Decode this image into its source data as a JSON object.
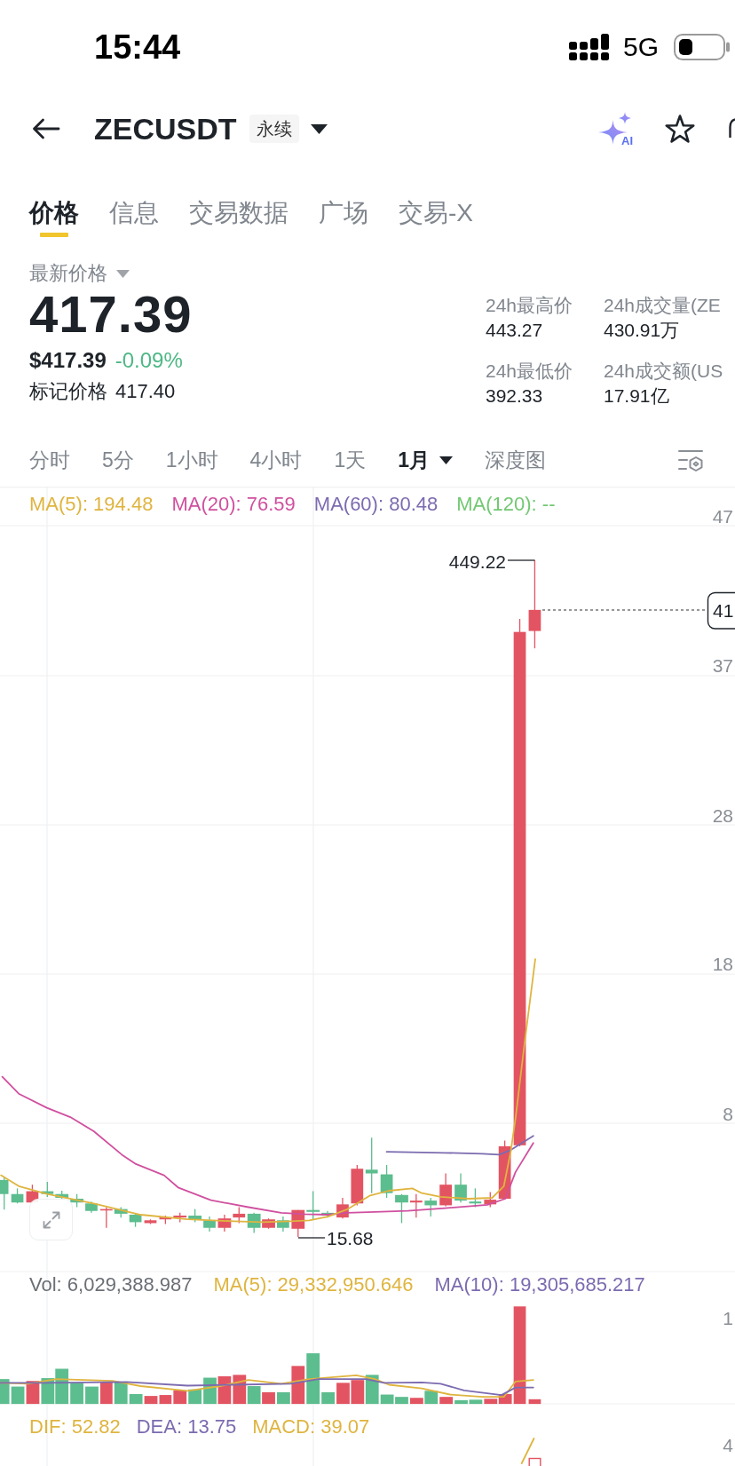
{
  "status_bar": {
    "time": "15:44",
    "network": "5G"
  },
  "header": {
    "symbol": "ZECUSDT",
    "contract_type": "永续",
    "ai_label": "AI",
    "favorite": false
  },
  "tabs": [
    {
      "label": "价格",
      "selected": true
    },
    {
      "label": "信息",
      "selected": false
    },
    {
      "label": "交易数据",
      "selected": false
    },
    {
      "label": "广场",
      "selected": false
    },
    {
      "label": "交易-X",
      "selected": false
    }
  ],
  "price_panel": {
    "label": "最新价格",
    "last_price": "417.39",
    "usd_price": "$417.39",
    "change": "-0.09%",
    "falling": true,
    "mark_label": "标记价格",
    "mark_price": "417.40"
  },
  "stats": [
    {
      "label": "24h最高价",
      "value": "443.27"
    },
    {
      "label": "24h成交量(ZE",
      "value": "430.91万"
    },
    {
      "label": "24h最低价",
      "value": "392.33"
    },
    {
      "label": "24h成交额(US",
      "value": "17.91亿"
    }
  ],
  "intervals": [
    {
      "label": "分时",
      "selected": false,
      "dropdown": false
    },
    {
      "label": "5分",
      "selected": false,
      "dropdown": false
    },
    {
      "label": "1小时",
      "selected": false,
      "dropdown": false
    },
    {
      "label": "4小时",
      "selected": false,
      "dropdown": false
    },
    {
      "label": "1天",
      "selected": false,
      "dropdown": false
    },
    {
      "label": "1月",
      "selected": true,
      "dropdown": true
    },
    {
      "label": "深度图",
      "selected": false,
      "dropdown": false
    }
  ],
  "chart": {
    "ma_legend": [
      {
        "label": "MA(5): 194.48",
        "color": "#dfb43f"
      },
      {
        "label": "MA(20): 76.59",
        "color": "#d0509f"
      },
      {
        "label": "MA(60): 80.48",
        "color": "#7c6bb0"
      },
      {
        "label": "MA(120): --",
        "color": "#72c872"
      }
    ],
    "price_axis": [
      "47",
      "37",
      "28",
      "18",
      "8"
    ],
    "high_label": "449.22",
    "low_label": "15.68",
    "last_price_tag": "41",
    "volume_legend": [
      {
        "label": "Vol: 6,029,388.987",
        "color": "#6b6f75"
      },
      {
        "label": "MA(5): 29,332,950.646",
        "color": "#dfb43f"
      },
      {
        "label": "MA(10): 19,305,685.217",
        "color": "#7c6bb0"
      }
    ],
    "volume_axis": [
      "1"
    ],
    "macd_legend": [
      {
        "label": "DIF: 52.82",
        "color": "#dfb43f"
      },
      {
        "label": "DEA: 13.75",
        "color": "#7c6bb0"
      },
      {
        "label": "MACD: 39.07",
        "color": "#dfb43f"
      }
    ],
    "macd_axis": [
      "4"
    ]
  }
}
